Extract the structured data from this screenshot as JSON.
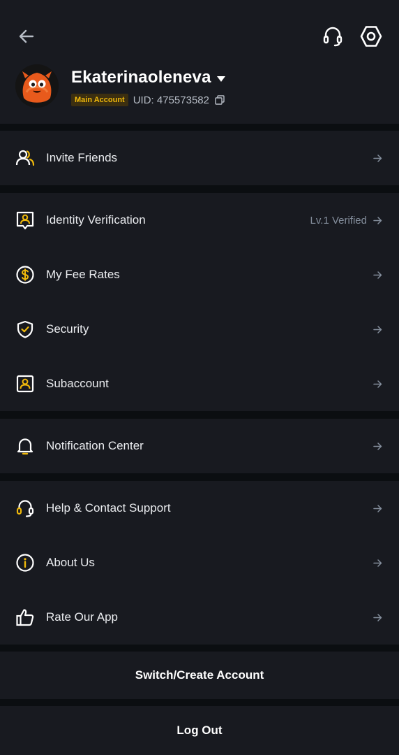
{
  "profile": {
    "username": "Ekaterinaoleneva",
    "badge": "Main Account",
    "uid": "UID: 475573582"
  },
  "accent_color": "#f0b90b",
  "menu": {
    "invite": {
      "label": "Invite Friends",
      "icon": "users-icon"
    },
    "identity": {
      "label": "Identity Verification",
      "value": "Lv.1 Verified",
      "icon": "id-badge-icon"
    },
    "fees": {
      "label": "My Fee Rates",
      "icon": "dollar-coin-icon"
    },
    "security": {
      "label": "Security",
      "icon": "shield-check-icon"
    },
    "subaccount": {
      "label": "Subaccount",
      "icon": "user-card-icon"
    },
    "notifications": {
      "label": "Notification Center",
      "icon": "bell-icon"
    },
    "help": {
      "label": "Help & Contact Support",
      "icon": "headset-icon"
    },
    "about": {
      "label": "About Us",
      "icon": "info-circle-icon"
    },
    "rate": {
      "label": "Rate Our App",
      "icon": "thumbs-up-icon"
    }
  },
  "actions": {
    "switch_account": "Switch/Create Account",
    "logout": "Log Out"
  }
}
